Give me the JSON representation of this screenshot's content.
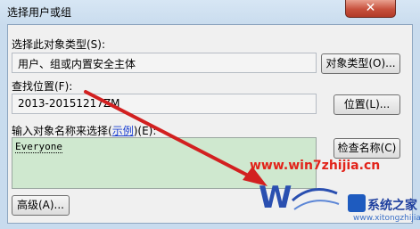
{
  "window": {
    "title": "选择用户或组",
    "close_label": "✕"
  },
  "object_type": {
    "label": "选择此对象类型(S):",
    "value": "用户、组或内置安全主体",
    "button": "对象类型(O)..."
  },
  "location": {
    "label": "查找位置(F):",
    "value": "2013-20151217ZM",
    "button": "位置(L)..."
  },
  "names": {
    "label_prefix": "输入对象名称来选择(",
    "label_link": "示例",
    "label_suffix": ")(E):",
    "value": "Everyone",
    "check_button": "检查名称(C)"
  },
  "footer": {
    "advanced_button": "高级(A)..."
  },
  "overlays": {
    "watermark_url": "www.win7zhijia.cn",
    "brand_name": "系统之家",
    "brand_url": "www.xitongzhijia.net"
  },
  "colors": {
    "arrow": "#d22020",
    "input_bg": "#cfe8cf",
    "watermark": "#e2231a"
  }
}
